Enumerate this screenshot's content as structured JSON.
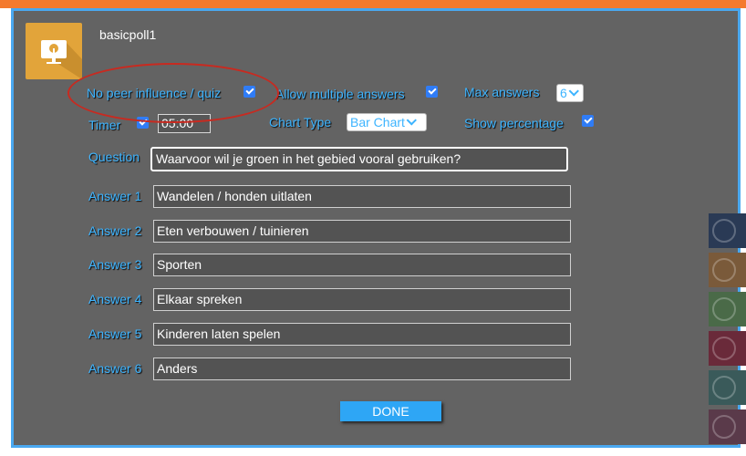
{
  "app": {
    "title": "basicpoll1",
    "icon": "presentation-poll-icon"
  },
  "options": {
    "no_peer_influence_label": "No peer influence / quiz",
    "no_peer_influence_checked": true,
    "allow_multiple_label": "Allow multiple answers",
    "allow_multiple_checked": true,
    "max_answers_label": "Max answers",
    "max_answers_value": "6",
    "timer_label": "Timer",
    "timer_checked": true,
    "timer_value": "05:00",
    "chart_type_label": "Chart Type",
    "chart_type_value": "Bar Chart",
    "show_percentage_label": "Show percentage",
    "show_percentage_checked": true
  },
  "question": {
    "label": "Question",
    "value": "Waarvoor wil je groen in het gebied vooral gebruiken?"
  },
  "answers": [
    {
      "label": "Answer 1",
      "value": "Wandelen / honden uitlaten"
    },
    {
      "label": "Answer 2",
      "value": "Eten verbouwen / tuinieren"
    },
    {
      "label": "Answer 3",
      "value": "Sporten"
    },
    {
      "label": "Answer 4",
      "value": "Elkaar spreken"
    },
    {
      "label": "Answer 5",
      "value": "Kinderen laten spelen"
    },
    {
      "label": "Answer 6",
      "value": "Anders"
    }
  ],
  "done_label": "DONE",
  "colors": {
    "accent": "#3db4ff",
    "top_bar": "#f47a2e",
    "dialog_bg": "#636363",
    "annotation": "#c82a20",
    "side_tabs": [
      "#2a3a55",
      "#7a5a3a",
      "#4a6a48",
      "#6a2a3a",
      "#3a5a5a",
      "#5a3a4a"
    ]
  }
}
